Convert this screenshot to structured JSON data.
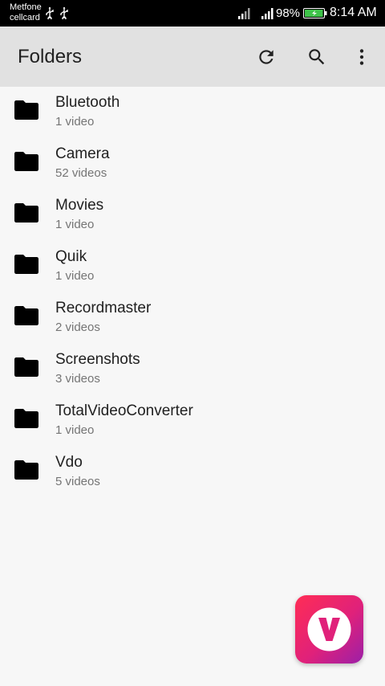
{
  "status_bar": {
    "carrier_line1": "Metfone",
    "carrier_line2": "cellcard",
    "battery_percent": "98%",
    "battery_level": 0.98,
    "time": "8:14 AM",
    "icons": [
      "usb-icon",
      "usb-icon",
      "signal-icon",
      "signal-icon",
      "battery-icon"
    ]
  },
  "app_bar": {
    "title": "Folders",
    "actions": [
      "refresh-icon",
      "search-icon",
      "more-vertical-icon"
    ]
  },
  "folders": [
    {
      "name": "Bluetooth",
      "count": "1 video"
    },
    {
      "name": "Camera",
      "count": "52 videos"
    },
    {
      "name": "Movies",
      "count": "1 video"
    },
    {
      "name": "Quik",
      "count": "1 video"
    },
    {
      "name": "Recordmaster",
      "count": "2 videos"
    },
    {
      "name": "Screenshots",
      "count": "3 videos"
    },
    {
      "name": "TotalVideoConverter",
      "count": "1 video"
    },
    {
      "name": "Vdo",
      "count": "5 videos"
    }
  ],
  "fab": {
    "icon": "app-logo-v-icon",
    "letter": "V"
  },
  "colors": {
    "status_bar_bg": "#000000",
    "app_bar_bg": "#e1e1e1",
    "list_bg": "#f7f7f7",
    "title_text": "#212121",
    "subtitle_text": "#757575",
    "battery_fill": "#3fc34a",
    "logo_gradient_start": "#ff2d55",
    "logo_gradient_end": "#9b1fa8"
  }
}
